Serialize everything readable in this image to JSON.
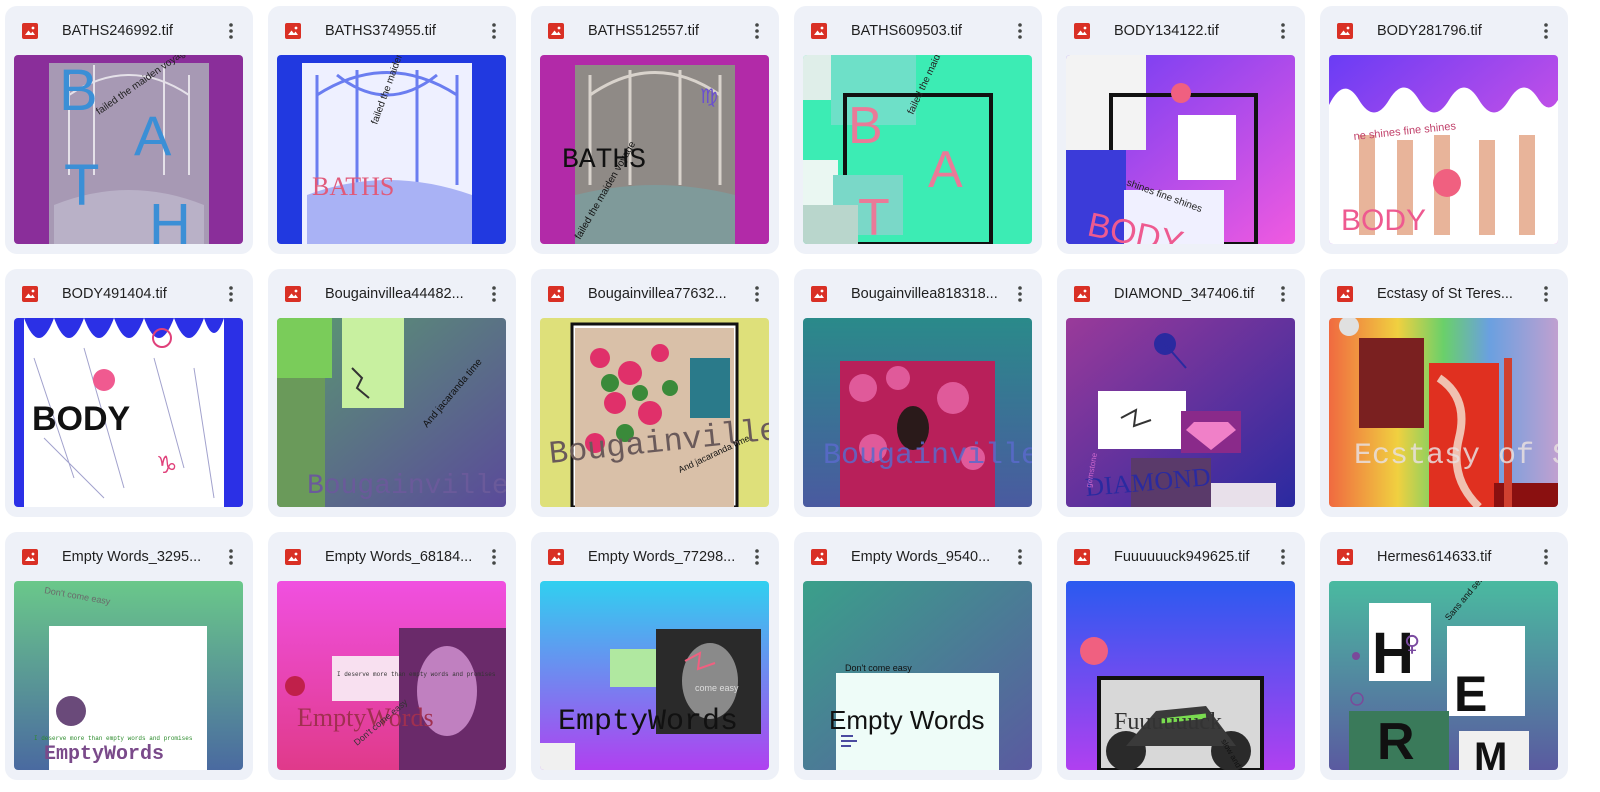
{
  "files": [
    {
      "name": "BATHS246992.tif",
      "file_type_icon": "image-file-icon",
      "menu_icon": "more-vert-icon"
    },
    {
      "name": "BATHS374955.tif",
      "file_type_icon": "image-file-icon",
      "menu_icon": "more-vert-icon"
    },
    {
      "name": "BATHS512557.tif",
      "file_type_icon": "image-file-icon",
      "menu_icon": "more-vert-icon"
    },
    {
      "name": "BATHS609503.tif",
      "file_type_icon": "image-file-icon",
      "menu_icon": "more-vert-icon"
    },
    {
      "name": "BODY134122.tif",
      "file_type_icon": "image-file-icon",
      "menu_icon": "more-vert-icon"
    },
    {
      "name": "BODY281796.tif",
      "file_type_icon": "image-file-icon",
      "menu_icon": "more-vert-icon"
    },
    {
      "name": "BODY491404.tif",
      "file_type_icon": "image-file-icon",
      "menu_icon": "more-vert-icon"
    },
    {
      "name": "Bougainvillea44482...",
      "file_type_icon": "image-file-icon",
      "menu_icon": "more-vert-icon"
    },
    {
      "name": "Bougainvillea77632...",
      "file_type_icon": "image-file-icon",
      "menu_icon": "more-vert-icon"
    },
    {
      "name": "Bougainvillea818318...",
      "file_type_icon": "image-file-icon",
      "menu_icon": "more-vert-icon"
    },
    {
      "name": "DIAMOND_347406.tif",
      "file_type_icon": "image-file-icon",
      "menu_icon": "more-vert-icon"
    },
    {
      "name": "Ecstasy of St Teres...",
      "file_type_icon": "image-file-icon",
      "menu_icon": "more-vert-icon"
    },
    {
      "name": "Empty Words_3295...",
      "file_type_icon": "image-file-icon",
      "menu_icon": "more-vert-icon"
    },
    {
      "name": "Empty Words_68184...",
      "file_type_icon": "image-file-icon",
      "menu_icon": "more-vert-icon"
    },
    {
      "name": "Empty Words_77298...",
      "file_type_icon": "image-file-icon",
      "menu_icon": "more-vert-icon"
    },
    {
      "name": "Empty Words_9540...",
      "file_type_icon": "image-file-icon",
      "menu_icon": "more-vert-icon"
    },
    {
      "name": "Fuuuuuuck949625.tif",
      "file_type_icon": "image-file-icon",
      "menu_icon": "more-vert-icon"
    },
    {
      "name": "Hermes614633.tif",
      "file_type_icon": "image-file-icon",
      "menu_icon": "more-vert-icon"
    }
  ],
  "thumb_text": {
    "t0_b": "B",
    "t0_a": "A",
    "t0_t": "T",
    "t0_h": "H",
    "t0_arc": "failed the maiden voyage",
    "t1_word": "BATHS",
    "t1_arc": "failed the maiden voyage",
    "t2_word": "BATHS",
    "t2_arc": "failed the maiden voyage",
    "t2_sym": "♍",
    "t3_b": "B",
    "t3_a": "A",
    "t3_t": "T",
    "t3_arc": "failed the maiden voyage",
    "t4_word": "BODY",
    "t4_arc": "shines fine shines",
    "t5_word": "BODY",
    "t5_arc": "ne shines fine shines",
    "t6_word": "BODY",
    "t6_sym": "♑",
    "t7_word": "Bougainvillea",
    "t7_arc": "And jacaranda time",
    "t8_word": "Bougainvillea",
    "t8_arc": "And jacaranda time",
    "t9_word": "Bougainvillea",
    "t10_word": "DIAMOND",
    "t10_small": "gemstone",
    "t11_word": "Ecstasy of St",
    "t12_word": "EmptyWords",
    "t12_arc": "Don't come easy",
    "t12_small": "I deserve more than empty words and promises",
    "t13_word": "EmptyWords",
    "t13_arc": "Don't come easy",
    "t13_small": "I deserve more than empty words and promises",
    "t14_word": "EmptyWords",
    "t14_arc": "come easy",
    "t15_word": "Empty Words",
    "t15_arc": "Don't come easy",
    "t16_word": "Fuuuuuuck",
    "t16_arc": "slow and steady",
    "t17_h": "H",
    "t17_e": "E",
    "t17_r": "R",
    "t17_m": "M",
    "t17_arc": "Sans and serifs, fat typeface",
    "t17_sym": "♀"
  },
  "colors": {
    "card_bg": "#eef1f8",
    "icon_red": "#d93025",
    "text": "#1f1f1f"
  }
}
